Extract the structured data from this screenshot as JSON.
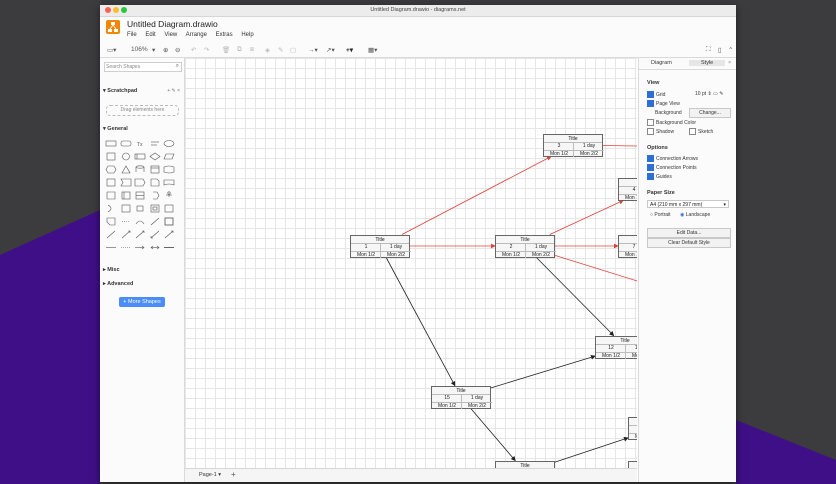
{
  "window": {
    "title": "Untitled Diagram.drawio - diagrams.net"
  },
  "app": {
    "doc_title": "Untitled Diagram.drawio",
    "menu": [
      "File",
      "Edit",
      "View",
      "Arrange",
      "Extras",
      "Help"
    ]
  },
  "toolbar": {
    "zoom": "106%"
  },
  "sidebar": {
    "search_placeholder": "Search Shapes",
    "scratchpad_label": "Scratchpad",
    "scratchpad_tools": "+ ✎ ×",
    "drag_hint": "Drag elements here",
    "general_label": "General",
    "misc_label": "Misc",
    "advanced_label": "Advanced",
    "more_shapes": "+ More Shapes"
  },
  "panel": {
    "tab_diagram": "Diagram",
    "tab_style": "Style",
    "view_head": "View",
    "grid_label": "Grid",
    "grid_size": "10 pt",
    "page_view_label": "Page View",
    "background_label": "Background",
    "change_button": "Change...",
    "background_color_label": "Background Color",
    "shadow_label": "Shadow",
    "sketch_label": "Sketch",
    "options_head": "Options",
    "connection_arrows_label": "Connection Arrows",
    "connection_points_label": "Connection Points",
    "guides_label": "Guides",
    "paper_size_head": "Paper Size",
    "paper_size_value": "A4 (210 mm x 297 mm)",
    "portrait_label": "Portrait",
    "landscape_label": "Landscape",
    "edit_data_button": "Edit Data...",
    "clear_style_button": "Clear Default Style"
  },
  "pages": {
    "current": "Page-1"
  },
  "diagram": {
    "edge_colors": {
      "red": "#e0413a",
      "black": "#222222"
    },
    "nodes": [
      {
        "title": "Title",
        "num": "1",
        "dur": "1 day",
        "start": "Mon 1/2",
        "end": "Mon 2/2"
      },
      {
        "title": "Title",
        "num": "3",
        "dur": "1 day",
        "start": "Mon 1/2",
        "end": "Mon 2/2"
      },
      {
        "title": "Title",
        "num": "2",
        "dur": "1 day",
        "start": "Mon 1/2",
        "end": "Mon 2/2"
      },
      {
        "title": "Title",
        "num": "4",
        "dur": "1 day",
        "start": "Mon 1/2",
        "end": "Mon 2/2"
      },
      {
        "title": "Title",
        "num": "7",
        "dur": "1 day",
        "start": "Mon 1/2",
        "end": "Mon 2/2"
      },
      {
        "title": "Title",
        "num": "10",
        "dur": "1 day",
        "start": "Mon 1/2",
        "end": "Mon 2/2"
      },
      {
        "title": "Title",
        "num": "12",
        "dur": "1 day",
        "start": "Mon 1/2",
        "end": "Mon 2/2"
      },
      {
        "title": "Title",
        "num": "13",
        "dur": "1 day",
        "start": "Mon 1/2",
        "end": "Mon 2/2"
      },
      {
        "title": "Title",
        "num": "15",
        "dur": "1 day",
        "start": "Mon 1/2",
        "end": "Mon 2/2"
      },
      {
        "title": "Title",
        "num": "16",
        "dur": "1 day",
        "start": "Mon 1/2",
        "end": "Mon 2/2"
      },
      {
        "title": "Title",
        "num": "",
        "dur": "",
        "start": "",
        "end": ""
      },
      {
        "title": "Title",
        "num": "",
        "dur": "",
        "start": "",
        "end": ""
      }
    ]
  }
}
